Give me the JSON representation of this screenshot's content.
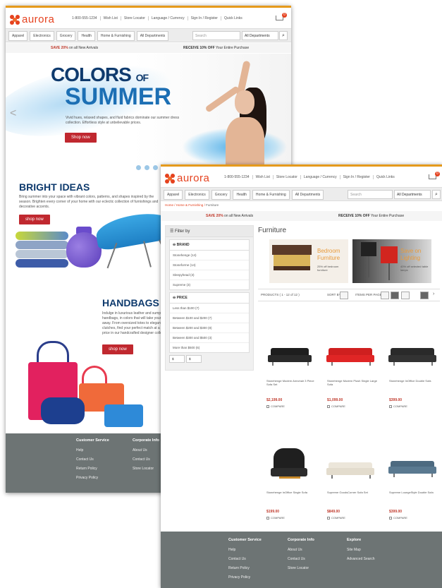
{
  "site": {
    "brand": "aurora"
  },
  "header": {
    "phone": "1-800-555-1234",
    "links": [
      "Wish List",
      "Store Locator",
      "Language / Currency",
      "Sign In / Register",
      "Quick Links"
    ],
    "cart_count": "0"
  },
  "nav": {
    "tabs": [
      "Apparel",
      "Electronics",
      "Grocery",
      "Health",
      "Home & Furnishing",
      "All Departments"
    ],
    "search_placeholder": "Search",
    "dept_select": "All Departments"
  },
  "promo": {
    "left_red": "SAVE 20%",
    "left_rest": "on all New Arrivals",
    "right_bold": "RECEIVE 10% OFF",
    "right_rest": "Your Entire Purchase"
  },
  "hero": {
    "title_a": "COLORS",
    "title_of": "OF",
    "title_b": "SUMMER",
    "text": "Vivid hues, relaxed shapes, and fluid fabrics dominate our summer dress collection. Effortless style at unbelievable prices.",
    "cta": "Shop now"
  },
  "bright": {
    "title": "BRIGHT IDEAS",
    "text": "Bring summer into your space with vibrant colors, patterns, and shapes inspired by the season. Brighten every corner of your home with our eclectic collection of furnishings and decorative accents.",
    "cta": "shop now"
  },
  "handbags": {
    "title": "HANDBAGS",
    "text": "Indulge in luxurious leather and sumptuous handbags, in colors that will take your breath away. From oversized totes to elegant clutches, find your perfect match at a perfect price in our handcrafted designer collection.",
    "cta": "shop now"
  },
  "footer": {
    "customer_service": {
      "title": "Customer Service",
      "links": [
        "Help",
        "Contact Us",
        "Return Policy",
        "Privacy Policy"
      ]
    },
    "corporate_info": {
      "title": "Corporate Info",
      "links": [
        "About Us",
        "Contact Us",
        "Store Locator"
      ]
    },
    "explore": {
      "title": "Explore",
      "links": [
        "Site Map",
        "Advanced Search"
      ]
    }
  },
  "category": {
    "breadcrumb": [
      "Home",
      "Home & Furnishing",
      "Furniture"
    ],
    "title": "Furniture",
    "filter_title": "Filter by",
    "brand_title": "BRAND",
    "brands": [
      "Stonehenge (14)",
      "Stoneforme (14)",
      "Sleepyhead (3)",
      "Supreme (3)"
    ],
    "price_title": "PRICE",
    "prices": [
      "Less than $100 (7)",
      "Between $100 and $200 (7)",
      "Between $200 and $300 (8)",
      "Between $300 and $500 (3)",
      "More than $500 (6)"
    ],
    "range_from": "$",
    "range_to": "$",
    "banner1": {
      "t1": "Bedroom",
      "t2": "Furniture",
      "sub": "25% off bedroom furniture"
    },
    "banner2": {
      "t1": "Save on",
      "t2": "Lighting",
      "sub": "40% off selected table lamps"
    },
    "sorter": {
      "products": "PRODUCTS ( 1 - 12 of 12 )",
      "sort": "SORT BY",
      "perpage": "ITEMS PER PAGE"
    },
    "compare_label": "COMPARE",
    "products": [
      {
        "name": "Stonehenge Modern Armchair 3 Piece Sofa Set",
        "price": "$2,199.00"
      },
      {
        "name": "Stonehenge Modern Plush Single Large Sofa",
        "price": "$1,099.00"
      },
      {
        "name": "Stonehenge InOffice Double Sofa",
        "price": "$399.00"
      },
      {
        "name": "Stonehenge InOffice Single Sofa",
        "price": "$199.00"
      },
      {
        "name": "Supreme GoodsCorner Sofa Set",
        "price": "$849.00"
      },
      {
        "name": "Supreme LoungeStyle Double Sofa",
        "price": "$399.00"
      }
    ]
  },
  "colors": {
    "accent": "#e5421f",
    "navy": "#0e3a6d",
    "blue": "#1c6fb4",
    "cta": "#c0282f",
    "footer": "#6d7474"
  }
}
